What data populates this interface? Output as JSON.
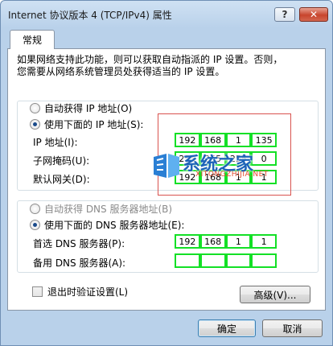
{
  "window": {
    "title": "Internet 协议版本 4 (TCP/IPv4) 属性"
  },
  "titlebar": {
    "help": "?",
    "close": "✕"
  },
  "tab": {
    "label": "常规"
  },
  "description": "如果网络支持此功能，则可以获取自动指派的 IP 设置。否则，\n您需要从网络系统管理员处获得适当的 IP 设置。",
  "ip_section": {
    "auto_label": "自动获得 IP 地址(O)",
    "manual_label": "使用下面的 IP 地址(S):",
    "selected": "manual",
    "fields": [
      {
        "label": "IP 地址(I):",
        "octets": [
          "192",
          "168",
          "1",
          "135"
        ]
      },
      {
        "label": "子网掩码(U):",
        "octets": [
          "255",
          "255",
          "255",
          "0"
        ]
      },
      {
        "label": "默认网关(D):",
        "octets": [
          "192",
          "168",
          "1",
          "1"
        ]
      }
    ]
  },
  "dns_section": {
    "auto_label": "自动获得 DNS 服务器地址(B)",
    "manual_label": "使用下面的 DNS 服务器地址(E):",
    "selected": "manual",
    "fields": [
      {
        "label": "首选 DNS 服务器(P):",
        "octets": [
          "192",
          "168",
          "1",
          "1"
        ]
      },
      {
        "label": "备用 DNS 服务器(A):",
        "octets": [
          "",
          "",
          "",
          ""
        ]
      }
    ]
  },
  "validate_checkbox": {
    "label": "退出时验证设置(L)",
    "checked": false
  },
  "buttons": {
    "advanced": "高级(V)...",
    "ok": "确定",
    "cancel": "取消"
  },
  "watermark": {
    "text": "系统之家",
    "sub": "XITONGZHIJIA.NET"
  }
}
